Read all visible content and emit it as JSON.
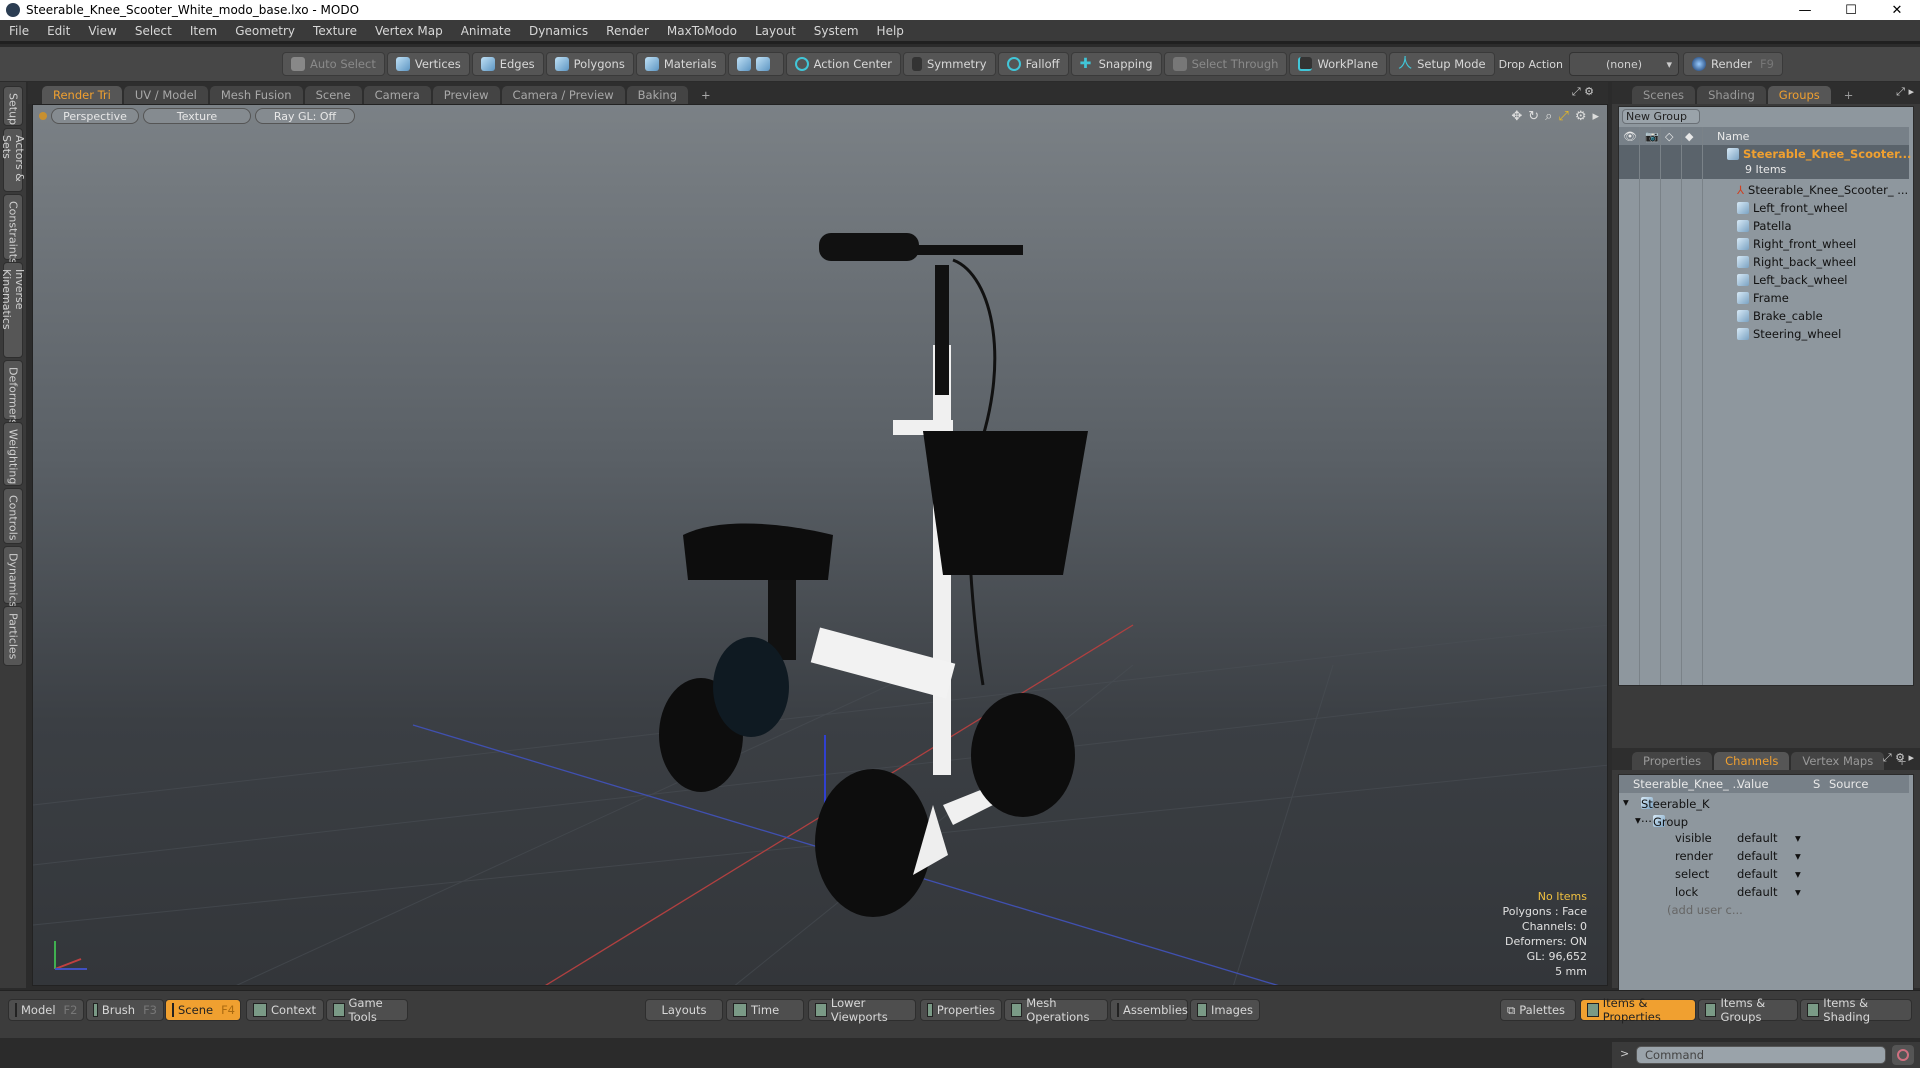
{
  "window": {
    "title": "Steerable_Knee_Scooter_White_modo_base.lxo - MODO",
    "minimize": "—",
    "maximize": "☐",
    "close": "✕"
  },
  "menu": [
    "File",
    "Edit",
    "View",
    "Select",
    "Item",
    "Geometry",
    "Texture",
    "Vertex Map",
    "Animate",
    "Dynamics",
    "Render",
    "MaxToModo",
    "Layout",
    "System",
    "Help"
  ],
  "toolbar": {
    "auto_select": "Auto Select",
    "vertices": "Vertices",
    "edges": "Edges",
    "polygons": "Polygons",
    "materials": "Materials",
    "action_center": "Action Center",
    "symmetry": "Symmetry",
    "falloff": "Falloff",
    "snapping": "Snapping",
    "select_through": "Select Through",
    "workplane": "WorkPlane",
    "setup_mode": "Setup Mode",
    "drop_action": "Drop Action",
    "drop_value": "(none)",
    "render": "Render",
    "render_key": "F9"
  },
  "left_tabs": [
    "Setup",
    "Actors & Sets",
    "Constraints",
    "Inverse Kinematics",
    "Deformers",
    "Weighting",
    "Controls",
    "Dynamics",
    "Particles"
  ],
  "viewport_tabs": [
    "Render Tri",
    "UV / Model",
    "Mesh Fusion",
    "Scene",
    "Camera",
    "Preview",
    "Camera / Preview",
    "Baking",
    "+"
  ],
  "viewport": {
    "perspective": "Perspective",
    "texture": "Texture",
    "raygl": "Ray GL: Off",
    "info": {
      "items": "No Items",
      "polygons": "Polygons : Face",
      "channels": "Channels: 0",
      "deformers": "Deformers: ON",
      "gl": "GL: 96,652",
      "scale": "5 mm"
    }
  },
  "groups_panel": {
    "tabs": [
      "Scenes",
      "Shading",
      "Groups",
      "+"
    ],
    "new_group": "New Group",
    "name_header": "Name",
    "group_name": "Steerable_Knee_Scooter...",
    "group_count": "9 Items",
    "items": [
      "Steerable_Knee_Scooter_ ...",
      "Left_front_wheel",
      "Patella",
      "Right_front_wheel",
      "Right_back_wheel",
      "Left_back_wheel",
      "Frame",
      "Brake_cable",
      "Steering_wheel"
    ]
  },
  "channels_panel": {
    "tabs": [
      "Properties",
      "Channels",
      "Vertex Maps",
      "+"
    ],
    "headers": {
      "name": "Steerable_Knee_ ...",
      "value": "Value",
      "s": "S",
      "source": "Source"
    },
    "root": "Steerable_K ...",
    "group": "Group",
    "rows": [
      {
        "name": "visible",
        "value": "default"
      },
      {
        "name": "render",
        "value": "default"
      },
      {
        "name": "select",
        "value": "default"
      },
      {
        "name": "lock",
        "value": "default"
      }
    ],
    "add": "(add user c..."
  },
  "command": {
    "placeholder": "Command",
    "prompt": ">"
  },
  "bottom": {
    "model": "Model",
    "model_key": "F2",
    "brush": "Brush",
    "brush_key": "F3",
    "scene": "Scene",
    "scene_key": "F4",
    "context": "Context",
    "game_tools": "Game Tools",
    "layouts": "Layouts",
    "time": "Time",
    "lower_viewports": "Lower Viewports",
    "properties": "Properties",
    "mesh_operations": "Mesh Operations",
    "assemblies": "Assemblies",
    "images": "Images",
    "palettes": "Palettes",
    "items_properties": "Items & Properties",
    "items_groups": "Items & Groups",
    "items_shading": "Items & Shading"
  }
}
